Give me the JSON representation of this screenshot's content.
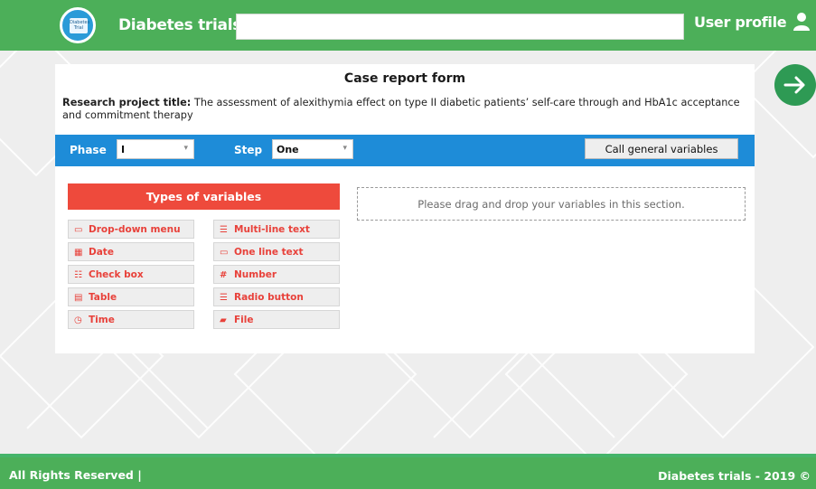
{
  "header": {
    "logo_text": "Diabetes Trial",
    "app_title": "Diabetes trials",
    "search_value": "",
    "user_profile_label": "User profile",
    "user_icon": "user-icon"
  },
  "nav": {
    "next_icon": "arrow-right-icon"
  },
  "form": {
    "title": "Case report form",
    "project_label": "Research project title:",
    "project_title": " The assessment of alexithymia effect on type II diabetic patients’ self-care through and HbA1c acceptance and commitment therapy",
    "phase_label": "Phase",
    "phase_value": "I",
    "step_label": "Step",
    "step_value": "One",
    "call_button": "Call general variables"
  },
  "types": {
    "header": "Types of variables",
    "items": [
      {
        "label": "Drop-down menu",
        "icon": "dropdown-icon"
      },
      {
        "label": "Multi-line text",
        "icon": "multiline-text-icon"
      },
      {
        "label": "Date",
        "icon": "calendar-icon"
      },
      {
        "label": "One line text",
        "icon": "single-line-text-icon"
      },
      {
        "label": "Check box",
        "icon": "checkbox-list-icon"
      },
      {
        "label": "Number",
        "icon": "hash-icon"
      },
      {
        "label": "Table",
        "icon": "table-icon"
      },
      {
        "label": "Radio button",
        "icon": "radio-list-icon"
      },
      {
        "label": "Time",
        "icon": "clock-icon"
      },
      {
        "label": "File",
        "icon": "folder-icon"
      }
    ]
  },
  "dropzone": {
    "text": "Please drag and drop your variables in this section."
  },
  "footer": {
    "left": "All Rights Reserved |",
    "right": "Diabetes trials - 2019 ©"
  },
  "colors": {
    "header_green": "#4caf59",
    "bar_blue": "#1e8cd8",
    "types_red": "#ee4a3c",
    "next_green": "#2e9a54"
  }
}
